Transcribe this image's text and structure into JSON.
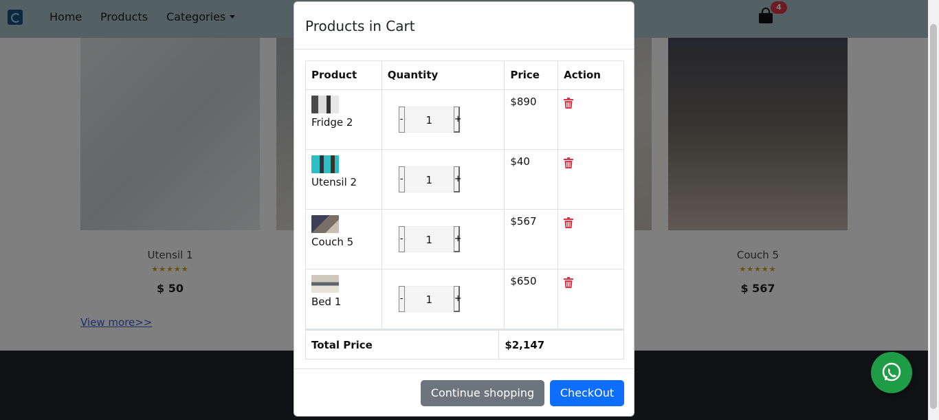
{
  "navbar": {
    "links": [
      "Home",
      "Products",
      "Categories"
    ],
    "cart_count": "4"
  },
  "products_bg": [
    {
      "name": "Utensil 1",
      "stars": "★★★★★",
      "price": "$ 50"
    },
    {
      "name": "Couch 5",
      "stars": "★★★★★",
      "price": "$ 567"
    }
  ],
  "view_more": "View more>>",
  "modal": {
    "title": "Products in Cart",
    "headers": [
      "Product",
      "Quantity",
      "Price",
      "Action"
    ],
    "items": [
      {
        "name": "Fridge 2",
        "qty": "1",
        "price": "$890"
      },
      {
        "name": "Utensil 2",
        "qty": "1",
        "price": "$40"
      },
      {
        "name": "Couch 5",
        "qty": "1",
        "price": "$567"
      },
      {
        "name": "Bed 1",
        "qty": "1",
        "price": "$650"
      }
    ],
    "qty_minus": "-",
    "qty_plus": "+",
    "total_label": "Total Price",
    "total_value": "$2,147",
    "continue_label": "Continue shopping",
    "checkout_label": "CheckOut"
  },
  "colors": {
    "navbar_bg": "#a9c3c9",
    "badge": "#dc3545",
    "trash": "#dc3545",
    "checkout": "#0d6efd",
    "continue": "#6c757d",
    "whatsapp": "#1f9c46"
  }
}
